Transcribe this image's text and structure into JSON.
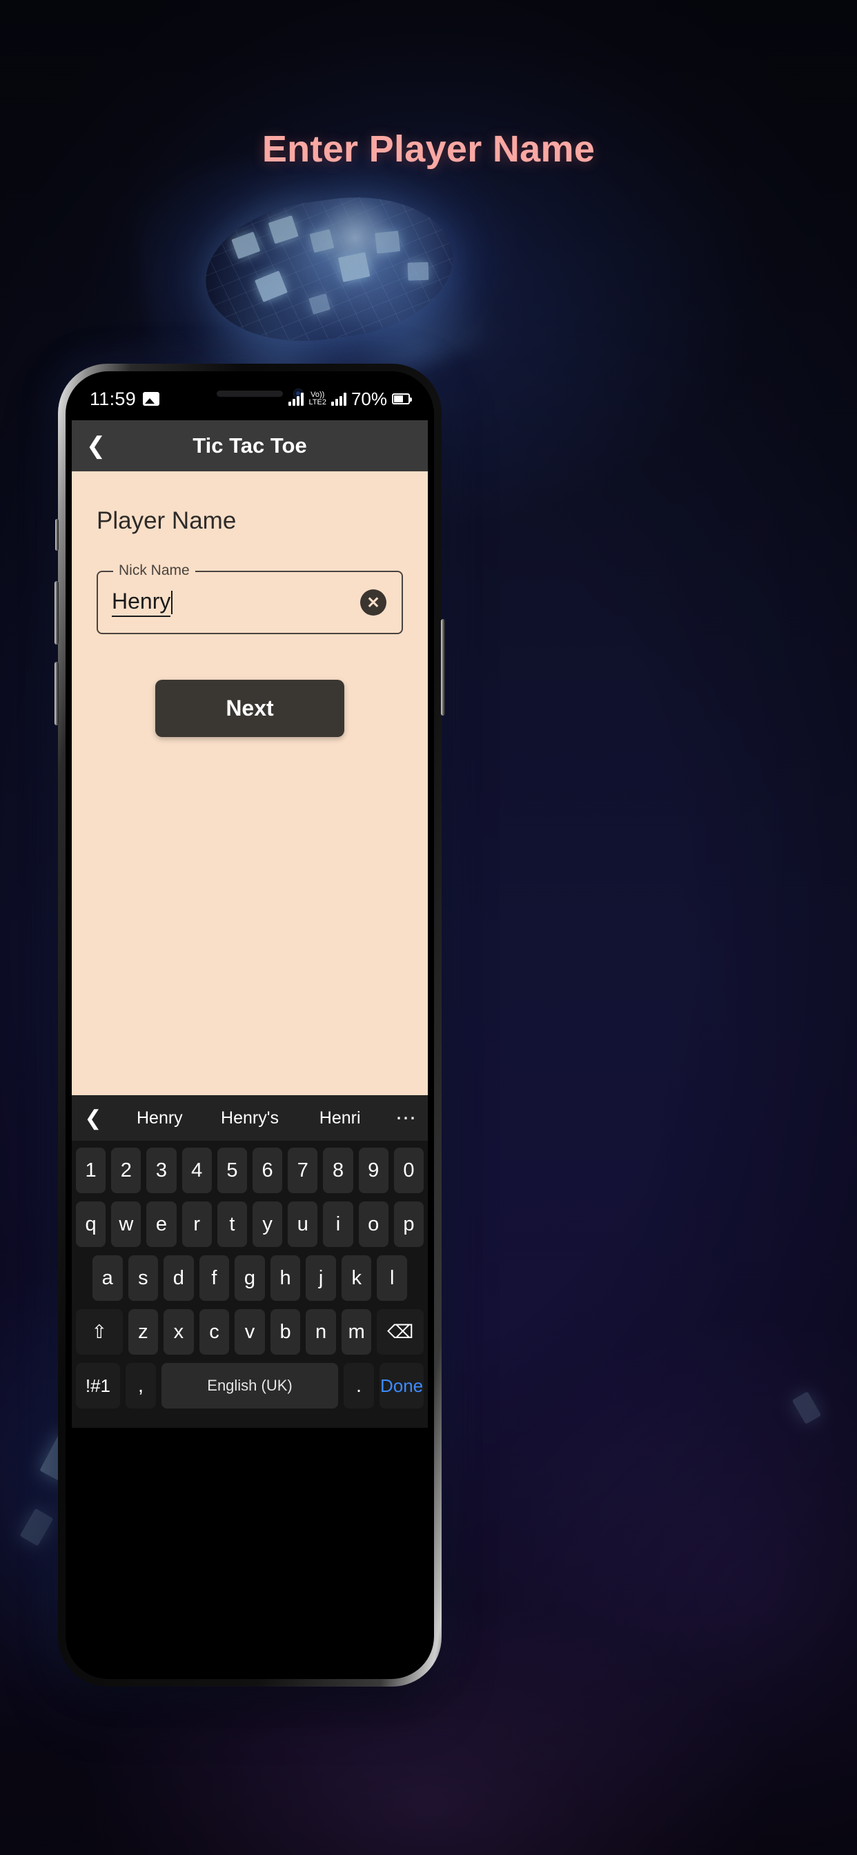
{
  "page": {
    "title": "Enter Player Name",
    "title_color": "#FBA8A3",
    "background_color": "#0e1026"
  },
  "status_bar": {
    "time": "11:59",
    "image_icon": "image-icon",
    "volte_top": "VoLTE",
    "volte_label": "Vo))",
    "network_label": "LTE2",
    "battery_percent": "70%"
  },
  "app_bar": {
    "back_icon": "chevron-left-icon",
    "title": "Tic Tac Toe"
  },
  "content": {
    "heading": "Player Name",
    "field": {
      "label": "Nick Name",
      "value": "Henry",
      "clear_icon": "close-circle-icon"
    },
    "next_button": "Next",
    "background_color": "#F9DFC8"
  },
  "suggestions": {
    "back_icon": "chevron-left-icon",
    "items": [
      "Henry",
      "Henry's",
      "Henri"
    ],
    "more_icon": "more-horizontal-icon"
  },
  "keyboard": {
    "rows": [
      [
        "1",
        "2",
        "3",
        "4",
        "5",
        "6",
        "7",
        "8",
        "9",
        "0"
      ],
      [
        "q",
        "w",
        "e",
        "r",
        "t",
        "y",
        "u",
        "i",
        "o",
        "p"
      ],
      [
        "a",
        "s",
        "d",
        "f",
        "g",
        "h",
        "j",
        "k",
        "l"
      ],
      [
        "z",
        "x",
        "c",
        "v",
        "b",
        "n",
        "m"
      ]
    ],
    "shift_icon": "shift-arrow-icon",
    "backspace_icon": "backspace-icon",
    "symbols_key": "!#1",
    "comma_key": ",",
    "space_key": "English (UK)",
    "period_key": ".",
    "done_key": "Done",
    "done_color": "#3C8BFF"
  }
}
